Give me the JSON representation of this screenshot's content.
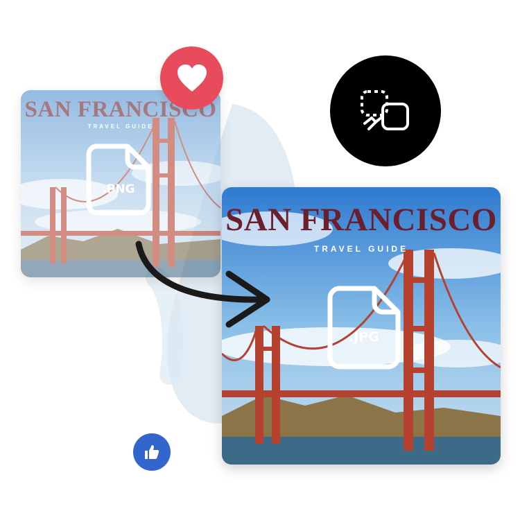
{
  "source_card": {
    "title": "SAN FRANCISCO",
    "subtitle": "TRAVEL GUIDE",
    "format_label": ".PNG"
  },
  "result_card": {
    "title": "SAN FRANCISCO",
    "subtitle": "TRAVEL GUIDE",
    "format_label": ".JPG"
  },
  "badges": {
    "heart_icon": "heart-icon",
    "convert_icon": "convert-icon",
    "like_icon": "thumbs-up-icon"
  },
  "colors": {
    "heart_bubble": "#e84b5b",
    "convert_bubble": "#000000",
    "like_bubble": "#3366cc",
    "title_text": "#6b1e2b",
    "bridge": "#b5412e"
  }
}
